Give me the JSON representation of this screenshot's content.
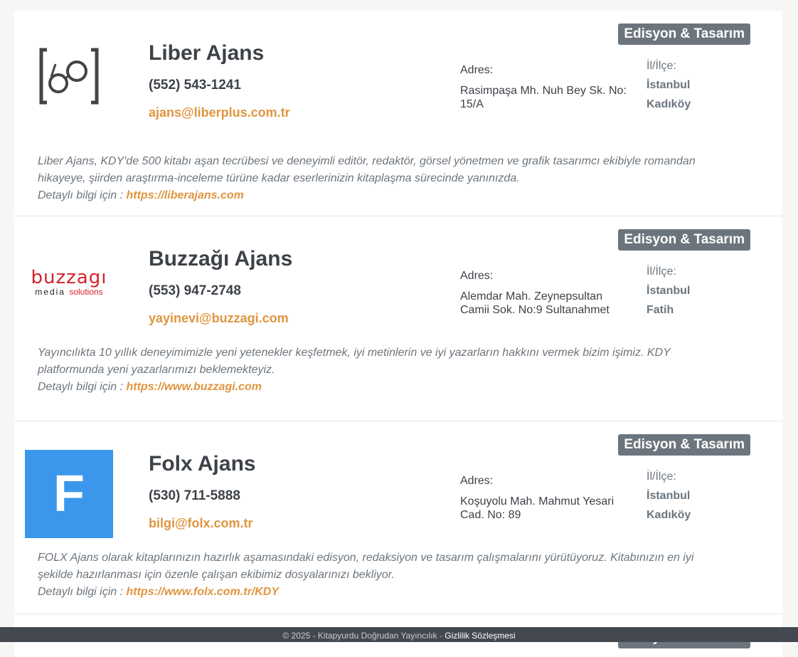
{
  "colors": {
    "accent": "#e0953f",
    "badge": "#6c757d",
    "text": "#3d4248",
    "footer_bg": "#444951",
    "folx_logo_bg": "#3b97ec"
  },
  "agencies": [
    {
      "badge": "Edisyon & Tasarım",
      "logo_icon": "glasses-bracket-logo",
      "name": "Liber Ajans",
      "phone": "(552) 543-1241",
      "email": "ajans@liberplus.com.tr",
      "address_label": "Adres:",
      "address": "Rasimpaşa Mh. Nuh Bey Sk. No: 15/A",
      "location_label": "İl/İlçe:",
      "city": "İstanbul",
      "district": "Kadıköy",
      "description": "Liber Ajans, KDY'de 500 kitabı aşan tecrübesi ve deneyimli editör, redaktör, görsel yönetmen ve grafik tasarımcı ekibiyle romandan hikayeye, şiirden araştırma-inceleme türüne kadar eserlerinizin kitaplaşma sürecinde yanınızda.",
      "more_label": "Detaylı bilgi için :",
      "website": "https://liberajans.com"
    },
    {
      "badge": "Edisyon & Tasarım",
      "logo_icon": "buzzagi-logo",
      "logo_text_top": "buzzagı",
      "logo_text_bottom_left": "media",
      "logo_text_bottom_right": "solutions",
      "name": "Buzzağı Ajans",
      "phone": "(553) 947-2748",
      "email": "yayinevi@buzzagi.com",
      "address_label": "Adres:",
      "address": "Alemdar Mah. Zeynepsultan Camii Sok. No:9 Sultanahmet",
      "location_label": "İl/İlçe:",
      "city": "İstanbul",
      "district": "Fatih",
      "description": "Yayıncılıkta 10 yıllık deneyimimizle yeni yetenekler keşfetmek, iyi metinlerin ve iyi yazarların hakkını vermek bizim işimiz. KDY platformunda yeni yazarlarımızı beklemekteyiz.",
      "more_label": "Detaylı bilgi için :",
      "website": "https://www.buzzagi.com"
    },
    {
      "badge": "Edisyon & Tasarım",
      "logo_icon": "folx-f-logo",
      "logo_letter": "F",
      "name": "Folx Ajans",
      "phone": "(530) 711-5888",
      "email": "bilgi@folx.com.tr",
      "address_label": "Adres:",
      "address": "Koşuyolu Mah. Mahmut Yesari Cad. No: 89",
      "location_label": "İl/İlçe:",
      "city": "İstanbul",
      "district": "Kadıköy",
      "description": "FOLX Ajans olarak kitaplarınızın hazırlık aşamasındaki edisyon, redaksiyon ve tasarım çalışmalarını yürütüyoruz. Kitabınızın en iyi şekilde hazırlanması için özenle çalışan ekibimiz dosyalarınızı bekliyor.",
      "more_label": "Detaylı bilgi için :",
      "website": "https://www.folx.com.tr/KDY"
    },
    {
      "badge": "Edisyon & Tasarım"
    }
  ],
  "footer": {
    "copyright": "© 2025 - Kitapyurdu Doğrudan Yayıncılık -",
    "privacy_link": "Gizlilik Sözleşmesi"
  }
}
